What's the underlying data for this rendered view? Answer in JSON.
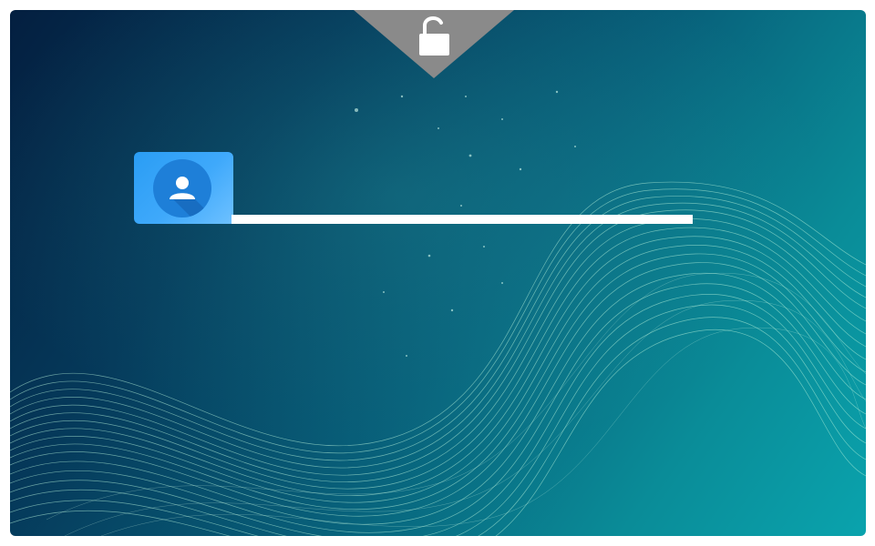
{
  "lock_screen": {
    "unlock_icon": "unlock-icon",
    "avatar_icon": "user-icon",
    "username": {
      "value": "",
      "placeholder": ""
    }
  },
  "colors": {
    "background_dark": "#041f40",
    "background_light": "#0aa3ad",
    "tab_gray": "#8a8a8a",
    "card_blue": "#3fa9fb",
    "avatar_blue": "#1e7fd8",
    "input_white": "#ffffff"
  }
}
